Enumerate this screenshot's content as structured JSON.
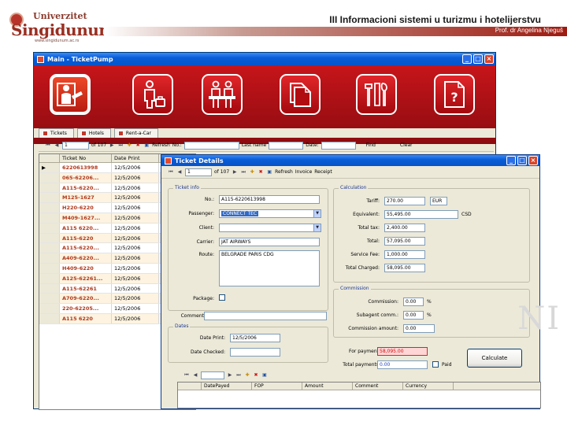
{
  "slide": {
    "logo_top": "Univerzitet",
    "logo_name": "Singidunum",
    "logo_url": "www.singidunum.ac.rs",
    "title": "III  Informacioni sistemi u turizmu i hotelijerstvu",
    "author": "Prof. dr Angelina Njeguš",
    "watermark": "NI"
  },
  "main_window": {
    "title": "Main - TicketPump",
    "banner_buttons": [
      {
        "icon": "agent-ticket-icon"
      },
      {
        "icon": "traveler-luggage-icon"
      },
      {
        "icon": "reception-desk-icon"
      },
      {
        "icon": "documents-icon"
      },
      {
        "icon": "tools-icon"
      },
      {
        "icon": "help-document-icon"
      }
    ],
    "tabs": [
      "Tickets",
      "Hotels",
      "Rent-a-Car"
    ],
    "toolbar": {
      "record_value": "1",
      "record_total": "of 107",
      "refresh": "Refresh",
      "no_label": "No.:",
      "last_name_label": "Last name",
      "date_label": "Date:",
      "find": "Find",
      "clear": "Clear"
    },
    "grid": {
      "headers": [
        "Ticket No",
        "Date Print"
      ],
      "rows": [
        {
          "ticket": "6220613998",
          "date": "12/5/2006"
        },
        {
          "ticket": "065-62206...",
          "date": "12/5/2006"
        },
        {
          "ticket": "A115-6220...",
          "date": "12/5/2006"
        },
        {
          "ticket": "M125-1627",
          "date": "12/5/2006"
        },
        {
          "ticket": "H220-6220",
          "date": "12/5/2006"
        },
        {
          "ticket": "M409-1627...",
          "date": "12/5/2006"
        },
        {
          "ticket": "A115 6220...",
          "date": "12/5/2006"
        },
        {
          "ticket": "A115-6220",
          "date": "12/5/2006"
        },
        {
          "ticket": "A115-6220...",
          "date": "12/5/2006"
        },
        {
          "ticket": "A409-6220...",
          "date": "12/5/2006"
        },
        {
          "ticket": "H409-6220",
          "date": "12/5/2006"
        },
        {
          "ticket": "A125-62261...",
          "date": "12/5/2006"
        },
        {
          "ticket": "A115-62261",
          "date": "12/5/2006"
        },
        {
          "ticket": "A709-6220...",
          "date": "12/5/2006"
        },
        {
          "ticket": "220-62205...",
          "date": "12/5/2006"
        },
        {
          "ticket": "A115 6220",
          "date": "12/5/2006"
        }
      ]
    }
  },
  "ticket_dialog": {
    "title": "Ticket Details",
    "toolbar": {
      "record_value": "1",
      "record_total": "of 107",
      "refresh": "Refresh",
      "invoice": "Invoice",
      "receipt": "Receipt"
    },
    "ticket_group": {
      "title": "Ticket info",
      "no_label": "No.:",
      "no_value": "A115-6220613998",
      "passenger_label": "Passenger:",
      "passenger_value": "CONNECT TEC",
      "client_label": "Client:",
      "client_value": "",
      "carrier_label": "Carrier:",
      "carrier_value": "JAT AIRWAYS",
      "route_label": "Route:",
      "route_value": "BELGRADE PARIS CDG",
      "package_label": "Package:",
      "comment_label": "Comment:",
      "comment_value": ""
    },
    "calc_group": {
      "title": "Calculation",
      "tariff_label": "Tariff:",
      "tariff_value": "270.00",
      "currency_value": "EUR",
      "equivalent_label": "Equivalent:",
      "equivalent_value": "55,495.00",
      "equivalent_currency": "CSD",
      "total_tax_label": "Total tax:",
      "total_tax_value": "2,400.00",
      "total_label": "Total:",
      "total_value": "57,095.00",
      "service_fee_label": "Service Fee:",
      "service_fee_value": "1,000.00",
      "total_charged_label": "Total Charged:",
      "total_charged_value": "58,095.00"
    },
    "commission_group": {
      "title": "Commission",
      "commission_label": "Commission:",
      "commission_value": "0.00",
      "subagent_label": "Subagent comm.:",
      "subagent_value": "0.00",
      "amount_label": "Commission amount:",
      "amount_value": "0.00",
      "percent": "%"
    },
    "dates_group": {
      "title": "Dates",
      "date_print_label": "Date Print:",
      "date_print_value": "12/5/2006",
      "date_checked_label": "Date Checked:",
      "date_checked_value": ""
    },
    "payment": {
      "for_payment_label": "For payment:",
      "for_payment_value": "58,095.00",
      "total_payments_label": "Total payments:",
      "total_payments_value": "0.00",
      "paid_label": "Paid",
      "calculate_button": "Calculate"
    },
    "payments_grid": {
      "headers": [
        "DatePayed",
        "FOP",
        "Amount",
        "Comment",
        "Currency"
      ]
    }
  }
}
